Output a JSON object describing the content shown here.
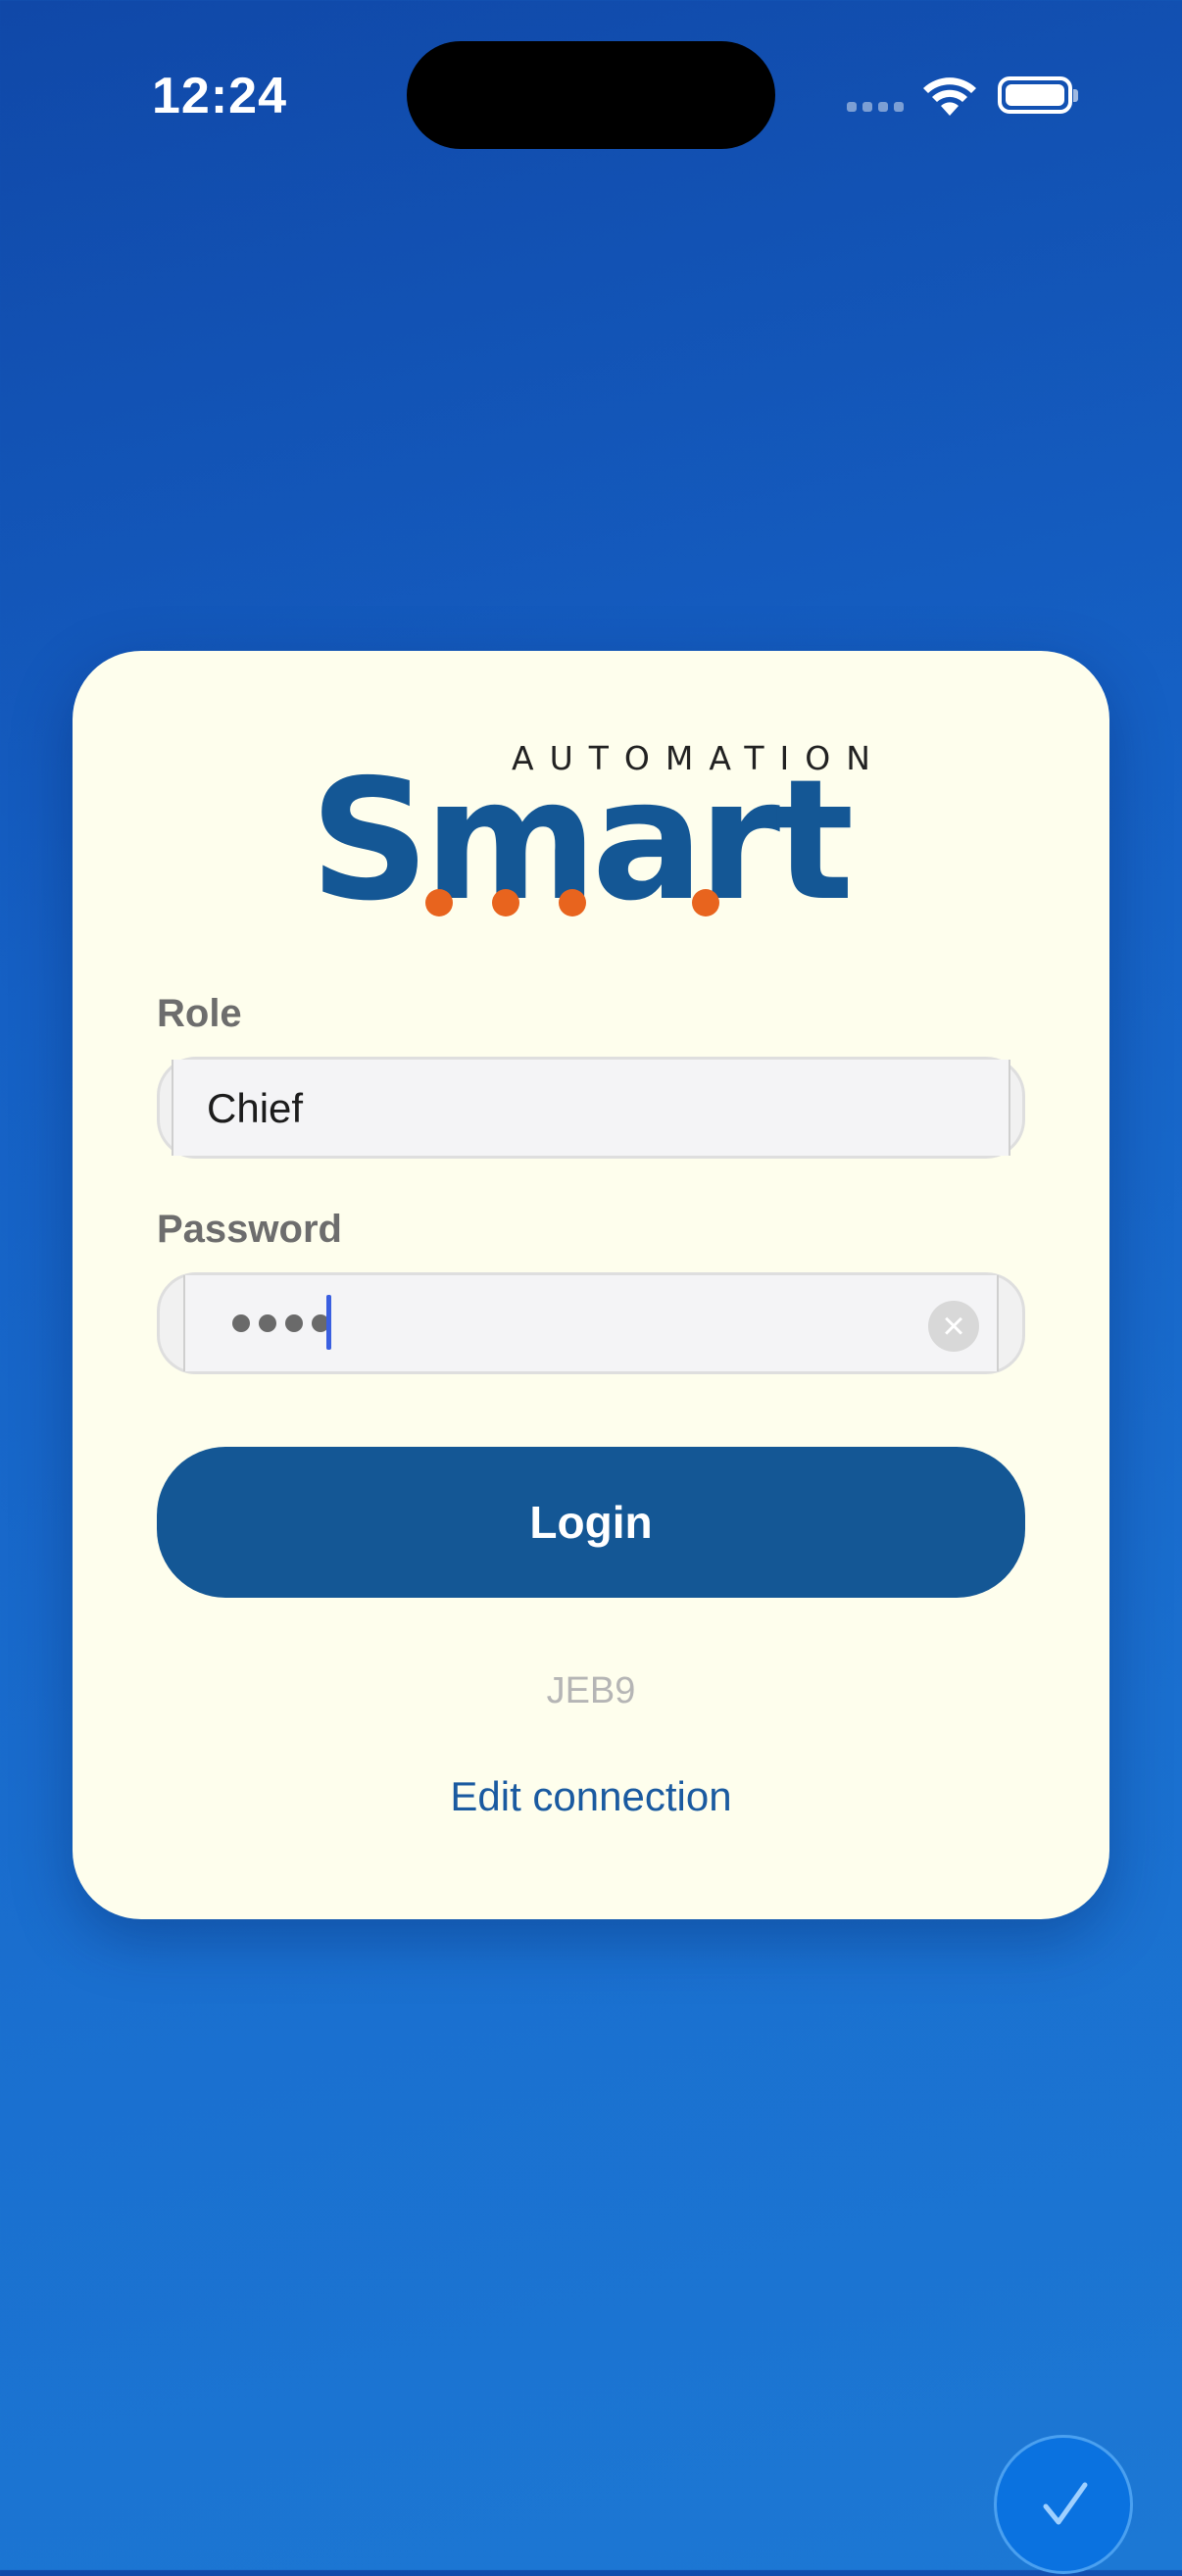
{
  "status_bar": {
    "time": "12:24"
  },
  "logo": {
    "top_text": "AUTOMATION",
    "main_text": "Smart",
    "brand_color": "#145795",
    "dot_color": "#e8641e"
  },
  "form": {
    "role_label": "Role",
    "role_value": "Chief",
    "password_label": "Password",
    "password_length": 4,
    "login_label": "Login"
  },
  "connection": {
    "code": "JEB9",
    "edit_label": "Edit connection"
  },
  "icons": {
    "clear": "close-icon",
    "fab": "checkmark-icon"
  }
}
